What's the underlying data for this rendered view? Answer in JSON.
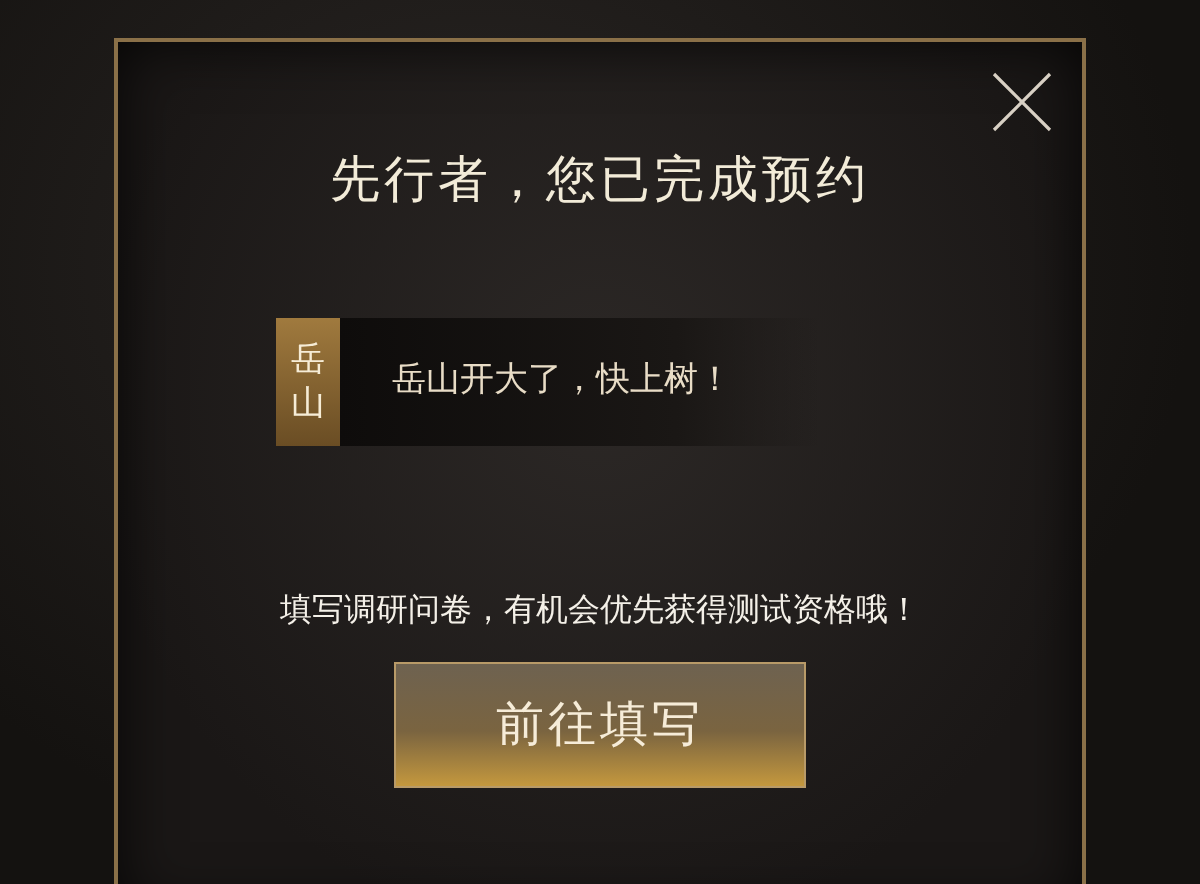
{
  "dialog": {
    "title": "先行者，您已完成预约",
    "message": {
      "speaker": "岳山",
      "text": "岳山开大了，快上树！"
    },
    "prompt": "填写调研问卷，有机会优先获得测试资格哦！",
    "button": "前往填写"
  }
}
